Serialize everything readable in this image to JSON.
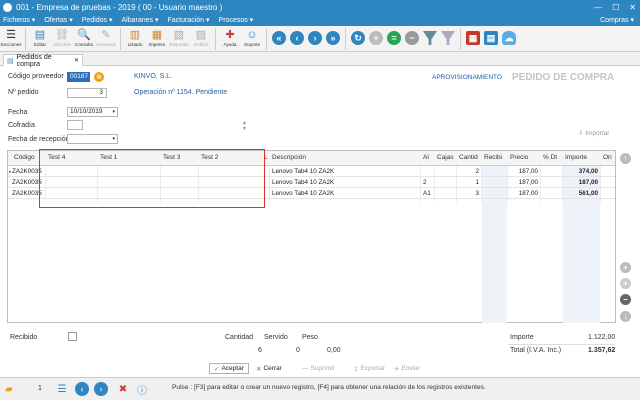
{
  "window": {
    "title": "001 - Empresa de pruebas - 2019 ( 00 - Usuario maestro )"
  },
  "menu": {
    "items": [
      "Ficheros",
      "Ofertas",
      "Pedidos",
      "Albaranes",
      "Facturación",
      "Procesos"
    ],
    "right": "Compras"
  },
  "toolbar": {
    "labels": {
      "secciones": "Secciones",
      "editar": "Editar",
      "vinculos": "Vínculos",
      "consulta": "Consulta",
      "anotacion": "Anotación",
      "listado": "Listado",
      "impreso": "Impreso",
      "etiquetas": "Etiquetas",
      "grafico": "Gráfico",
      "ayuda": "Ayuda",
      "soporte": "Soporte"
    }
  },
  "tab": {
    "label": "Pedidos de compra"
  },
  "form": {
    "proveedor_label": "Código proveedor",
    "proveedor_value": "00187",
    "proveedor_name": "KINVO, S.L.",
    "pedido_label": "Nº pedido",
    "pedido_value": "3",
    "operacion": "Operación nº 1154. Pendiente",
    "aprovisionamiento": "APROVISIONAMIENTO",
    "doc_title": "PEDIDO DE COMPRA",
    "fecha_label": "Fecha",
    "fecha_value": "10/10/2019",
    "cofradia_label": "Cofradía",
    "recepcion_label": "Fecha de recepción",
    "importar": "Importar"
  },
  "grid": {
    "headers": {
      "codigo": "Código",
      "t4": "Test 4",
      "t1": "Test 1",
      "t3": "Test 3",
      "t2": "Test 2",
      "l": "L",
      "desc": "Descripción",
      "al": "Al",
      "cajas": "Cajas",
      "cantidad": "Cantid",
      "recibido": "Recibi",
      "precio": "Precio",
      "dt": "% Dt",
      "importe": "Importe",
      "ori": "Ori"
    },
    "rows": [
      {
        "codigo": "ZA2K0035",
        "desc": "Lenovo Tab4 10 ZA2K",
        "al": "",
        "cantidad": "2",
        "precio": "187,00",
        "importe": "374,00"
      },
      {
        "codigo": "ZA2K0035",
        "desc": "Lenovo Tab4 10 ZA2K",
        "al": "2",
        "cantidad": "1",
        "precio": "187,00",
        "importe": "187,00"
      },
      {
        "codigo": "ZA2K0035",
        "desc": "Lenovo Tab4 10 ZA2K",
        "al": "A1",
        "cantidad": "3",
        "precio": "187,00",
        "importe": "561,00"
      }
    ]
  },
  "totals": {
    "recibido_label": "Recibido",
    "cantidad_label": "Cantidad",
    "servido_label": "Servido",
    "peso_label": "Peso",
    "cantidad": "6",
    "servido": "0",
    "peso": "0,00",
    "importe_label": "Importe",
    "importe": "1.122,00",
    "total_label": "Total (I.V.A. Inc.)",
    "total": "1.357,62"
  },
  "buttons": {
    "aceptar": "Aceptar",
    "cerrar": "Cerrar",
    "suprimir": "Suprimir",
    "exportar": "Exportar",
    "enviar": "Enviar"
  },
  "status": {
    "count": "1",
    "message": "Pulse : [F3] para editar o crear un nuevo registro, [F4] para obtener una relación de los registros existentes."
  },
  "colors": {
    "titlebar": "#2e86c1",
    "highlight_box": "#e03030",
    "link": "#1f5fa8"
  }
}
